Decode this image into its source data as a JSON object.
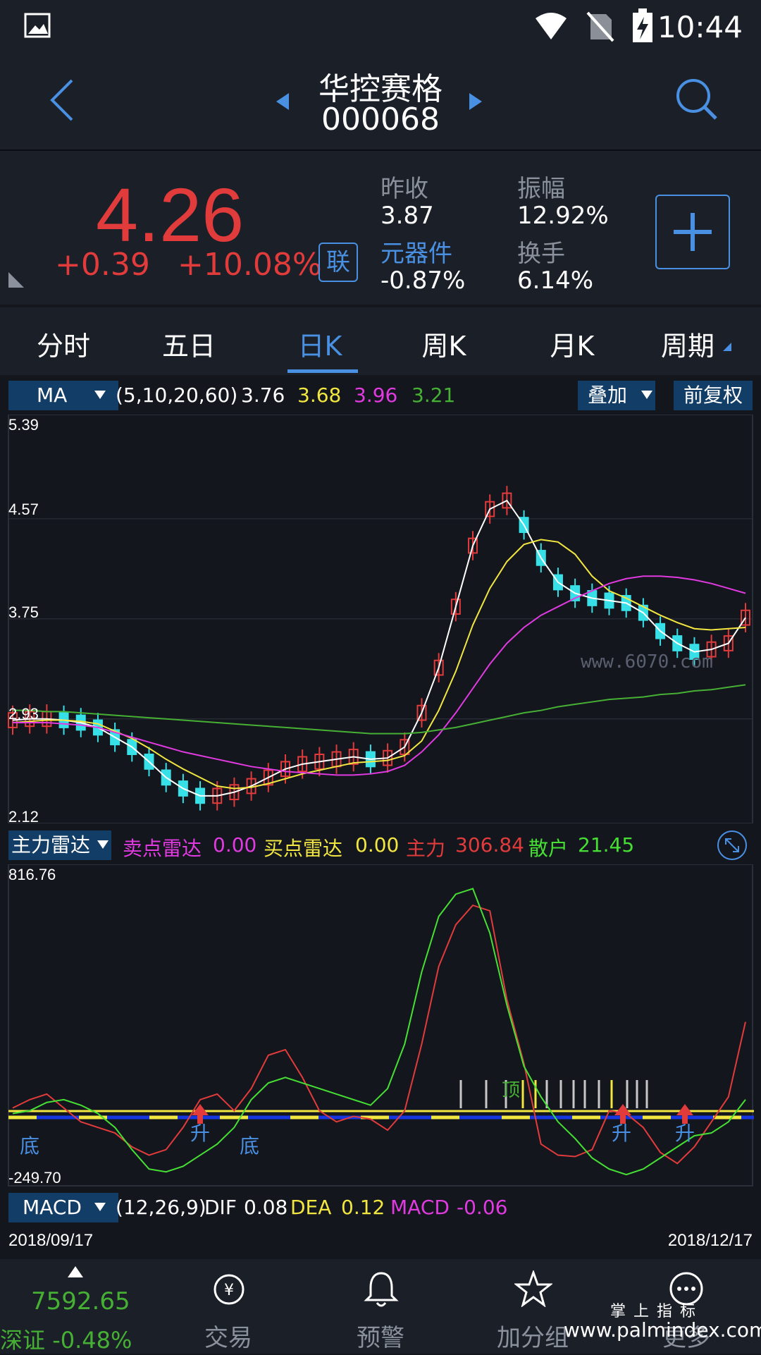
{
  "status_bar": {
    "time": "10:44"
  },
  "header": {
    "name": "华控赛格",
    "code": "000068"
  },
  "quote": {
    "price": "4.26",
    "change": "+0.39",
    "change_pct": "+10.08%",
    "lian": "联",
    "prev_close_label": "昨收",
    "prev_close": "3.87",
    "amplitude_label": "振幅",
    "amplitude": "12.92%",
    "sector_label": "元器件",
    "sector_value": "-0.87%",
    "turnover_label": "换手",
    "turnover": "6.14%"
  },
  "tabs": [
    "分时",
    "五日",
    "日K",
    "周K",
    "月K",
    "周期"
  ],
  "ma_bar": {
    "name": "MA",
    "params": "(5,10,20,60)",
    "ma5": "3.76",
    "ma10": "3.68",
    "ma20": "3.96",
    "ma60": "3.21",
    "overlay": "叠加",
    "adjust": "前复权"
  },
  "price_axis": [
    "5.39",
    "4.57",
    "3.75",
    "2.93",
    "2.12"
  ],
  "watermark": "www.6070.com",
  "radar_bar": {
    "name": "主力雷达",
    "sell_label": "卖点雷达",
    "sell_val": "0.00",
    "buy_label": "买点雷达",
    "buy_val": "0.00",
    "main_label": "主力",
    "main_val": "306.84",
    "retail_label": "散户",
    "retail_val": "21.45"
  },
  "radar_axis": {
    "top": "816.76",
    "bottom": "-249.70"
  },
  "radar_marks": {
    "bottom": "底",
    "rise": "升",
    "top": "顶"
  },
  "macd_bar": {
    "name": "MACD",
    "params": "(12,26,9)",
    "dif_label": "DIF",
    "dif": "0.08",
    "dea_label": "DEA",
    "dea": "0.12",
    "macd_label": "MACD",
    "macd": "-0.06"
  },
  "dates": {
    "start": "2018/09/17",
    "end": "2018/12/17"
  },
  "nav": {
    "index_value": "7592.65",
    "index_name": "深证",
    "index_pct": "-0.48%",
    "trade": "交易",
    "alert": "预警",
    "watchlist": "加分组",
    "more": "更多"
  },
  "footer_watermark": {
    "line1": "掌 上 指 标",
    "line2": "www.palmindex.com"
  },
  "colors": {
    "up": "#e23b3b",
    "down": "#36e0e6",
    "accent": "#4a90e2",
    "ma5": "#ffffff",
    "ma10": "#f2e641",
    "ma20": "#e03ae0",
    "ma60": "#46b034"
  },
  "chart_data": [
    {
      "type": "line",
      "title": "",
      "series": [
        {
          "name": "MA5",
          "values": [
            2.92,
            2.93,
            2.93,
            2.92,
            2.9,
            2.86,
            2.78,
            2.7,
            2.58,
            2.45,
            2.36,
            2.3,
            2.3,
            2.33,
            2.38,
            2.45,
            2.52,
            2.56,
            2.58,
            2.6,
            2.62,
            2.6,
            2.61,
            2.7,
            2.98,
            3.35,
            3.85,
            4.35,
            4.65,
            4.72,
            4.52,
            4.25,
            4.05,
            3.96,
            3.92,
            3.9,
            3.88,
            3.8,
            3.65,
            3.55,
            3.48,
            3.5,
            3.55,
            3.76
          ]
        },
        {
          "name": "MA10",
          "values": [
            2.9,
            2.91,
            2.92,
            2.92,
            2.91,
            2.89,
            2.83,
            2.77,
            2.69,
            2.6,
            2.52,
            2.45,
            2.38,
            2.36,
            2.37,
            2.4,
            2.44,
            2.48,
            2.51,
            2.54,
            2.57,
            2.58,
            2.59,
            2.63,
            2.75,
            3.0,
            3.32,
            3.7,
            4.0,
            4.22,
            4.36,
            4.4,
            4.38,
            4.28,
            4.1,
            3.98,
            3.92,
            3.85,
            3.78,
            3.72,
            3.67,
            3.66,
            3.67,
            3.68
          ]
        },
        {
          "name": "MA20",
          "values": [
            2.9,
            2.9,
            2.9,
            2.89,
            2.88,
            2.86,
            2.82,
            2.78,
            2.74,
            2.7,
            2.66,
            2.63,
            2.6,
            2.57,
            2.54,
            2.52,
            2.5,
            2.49,
            2.48,
            2.47,
            2.47,
            2.48,
            2.5,
            2.55,
            2.66,
            2.8,
            2.98,
            3.18,
            3.38,
            3.55,
            3.68,
            3.78,
            3.85,
            3.92,
            3.98,
            4.04,
            4.08,
            4.1,
            4.1,
            4.09,
            4.07,
            4.04,
            4.0,
            3.96
          ]
        },
        {
          "name": "MA60",
          "values": [
            3.0,
            3.0,
            2.99,
            2.99,
            2.98,
            2.97,
            2.96,
            2.95,
            2.94,
            2.93,
            2.92,
            2.91,
            2.9,
            2.89,
            2.88,
            2.87,
            2.86,
            2.85,
            2.84,
            2.83,
            2.82,
            2.81,
            2.81,
            2.81,
            2.82,
            2.84,
            2.86,
            2.89,
            2.92,
            2.95,
            2.98,
            3.0,
            3.03,
            3.05,
            3.07,
            3.09,
            3.1,
            3.11,
            3.13,
            3.14,
            3.16,
            3.17,
            3.19,
            3.21
          ]
        }
      ]
    },
    {
      "type": "line",
      "title": "",
      "ylim": [
        -249.7,
        816.76
      ],
      "series": [
        {
          "name": "主力",
          "values": [
            -10,
            20,
            40,
            -10,
            -60,
            -80,
            -100,
            -150,
            -180,
            -160,
            -80,
            20,
            40,
            -20,
            60,
            180,
            200,
            100,
            -20,
            -60,
            -40,
            -50,
            -90,
            -20,
            220,
            500,
            650,
            720,
            700,
            380,
            150,
            -140,
            -180,
            -185,
            -160,
            -20,
            -30,
            -80,
            -170,
            -210,
            -150,
            -60,
            30,
            300
          ]
        },
        {
          "name": "散户",
          "values": [
            -30,
            -20,
            10,
            20,
            0,
            -30,
            -80,
            -160,
            -230,
            -240,
            -220,
            -180,
            -140,
            -80,
            20,
            80,
            100,
            80,
            60,
            40,
            20,
            0,
            60,
            220,
            480,
            680,
            760,
            780,
            620,
            360,
            140,
            30,
            -60,
            -120,
            -190,
            -230,
            -250,
            -230,
            -190,
            -150,
            -110,
            -100,
            -60,
            20
          ]
        }
      ]
    }
  ]
}
